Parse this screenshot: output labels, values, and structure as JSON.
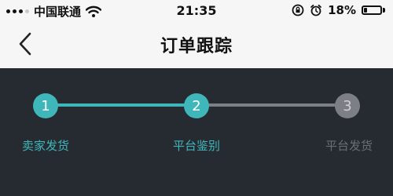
{
  "status_bar": {
    "carrier": "中国联通",
    "time": "21:35",
    "battery_percent": "18%",
    "battery_level": 0.18,
    "icons": [
      "signal-dots-icon",
      "wifi-icon",
      "alarm-clock-icon",
      "lock-rotation-icon",
      "battery-icon"
    ]
  },
  "nav": {
    "title": "订单跟踪",
    "back_icon": "chevron-left-icon"
  },
  "tracking": {
    "steps": [
      {
        "number": "1",
        "label": "卖家发货",
        "state": "done"
      },
      {
        "number": "2",
        "label": "平台鉴别",
        "state": "current"
      },
      {
        "number": "3",
        "label": "平台发货",
        "state": "pending"
      }
    ],
    "colors": {
      "active": "#3fb7ba",
      "inactive": "#7d7f86",
      "panel_background": "#262a31"
    }
  }
}
